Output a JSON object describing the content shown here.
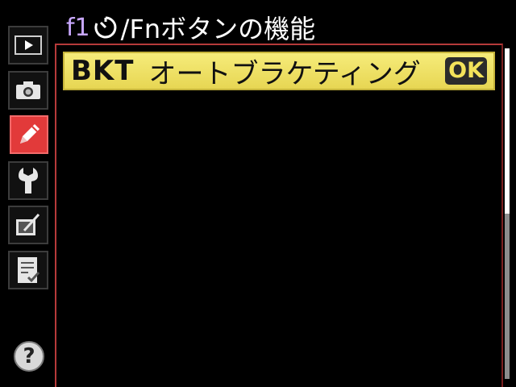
{
  "header": {
    "code": "f1",
    "timer_icon": "self-timer-icon",
    "title": "/Fnボタンの機能"
  },
  "sidebar": {
    "items": [
      {
        "icon": "playback-icon",
        "active": false
      },
      {
        "icon": "camera-icon",
        "active": false
      },
      {
        "icon": "pencil-icon",
        "active": true
      },
      {
        "icon": "wrench-icon",
        "active": false
      },
      {
        "icon": "retouch-icon",
        "active": false
      },
      {
        "icon": "my-menu-icon",
        "active": false
      }
    ],
    "help_label": "?"
  },
  "menu": {
    "selected_item": {
      "code": "BKT",
      "label": "オートブラケティング",
      "ok_label": "OK"
    }
  },
  "scrollbar": {
    "position": 0,
    "visible_fraction": 0.5
  },
  "colors": {
    "highlight": "#f3e46a",
    "active_tab": "#e23a3a",
    "header_code": "#c9a8ff",
    "frame_border": "#b63a3a",
    "ok_text": "#f3e25a"
  }
}
